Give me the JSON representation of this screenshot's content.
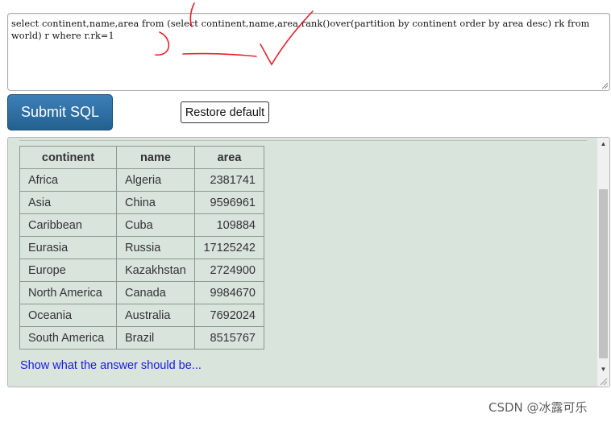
{
  "editor": {
    "query": "select continent,name,area from (select continent,name,area,rank()over(partition by continent order by area desc) rk from world) r where r.rk=1"
  },
  "buttons": {
    "submit_label": "Submit SQL",
    "restore_label": "Restore default"
  },
  "results": {
    "columns": [
      "continent",
      "name",
      "area"
    ],
    "rows": [
      [
        "Africa",
        "Algeria",
        "2381741"
      ],
      [
        "Asia",
        "China",
        "9596961"
      ],
      [
        "Caribbean",
        "Cuba",
        "109884"
      ],
      [
        "Eurasia",
        "Russia",
        "17125242"
      ],
      [
        "Europe",
        "Kazakhstan",
        "2724900"
      ],
      [
        "North America",
        "Canada",
        "9984670"
      ],
      [
        "Oceania",
        "Australia",
        "7692024"
      ],
      [
        "South America",
        "Brazil",
        "8515767"
      ]
    ],
    "answer_link": "Show what the answer should be..."
  },
  "watermark": "CSDN @冰露可乐",
  "colors": {
    "annotation": "#e8202a",
    "submit_bg": "#2b6a9c",
    "panel_bg": "#d9e4dc",
    "link": "#1a1adf"
  }
}
